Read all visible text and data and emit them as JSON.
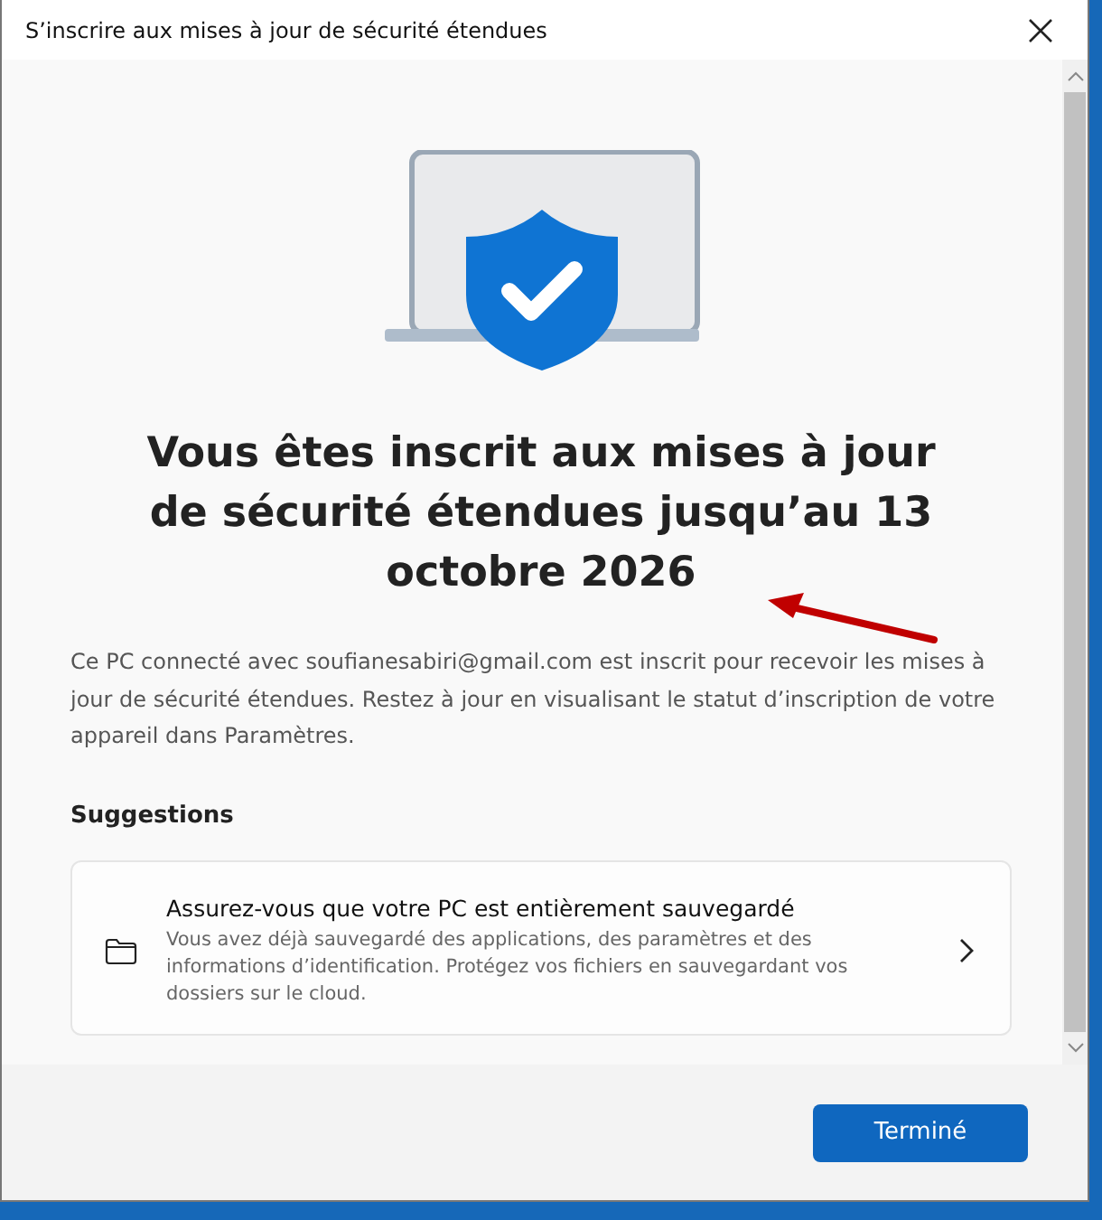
{
  "window": {
    "title": "S’inscrire aux mises à jour de sécurité étendues"
  },
  "heading": "Vous êtes inscrit aux mises à jour de sécurité étendues jusqu’au 13 octobre 2026",
  "description": "Ce PC connecté avec soufianesabiri@gmail.com est inscrit pour recevoir les mises à jour de sécurité étendues. Restez à jour en visualisant le statut d’inscription de votre appareil dans Paramètres.",
  "suggestions": {
    "title": "Suggestions",
    "items": [
      {
        "title": "Assurez-vous que votre PC est entièrement sauvegardé",
        "text": "Vous avez déjà sauvegardé des applications, des paramètres et des informations d’identification. Protégez vos fichiers en sauvegardant vos dossiers sur le cloud."
      }
    ]
  },
  "buttons": [
    "Terminé"
  ]
}
